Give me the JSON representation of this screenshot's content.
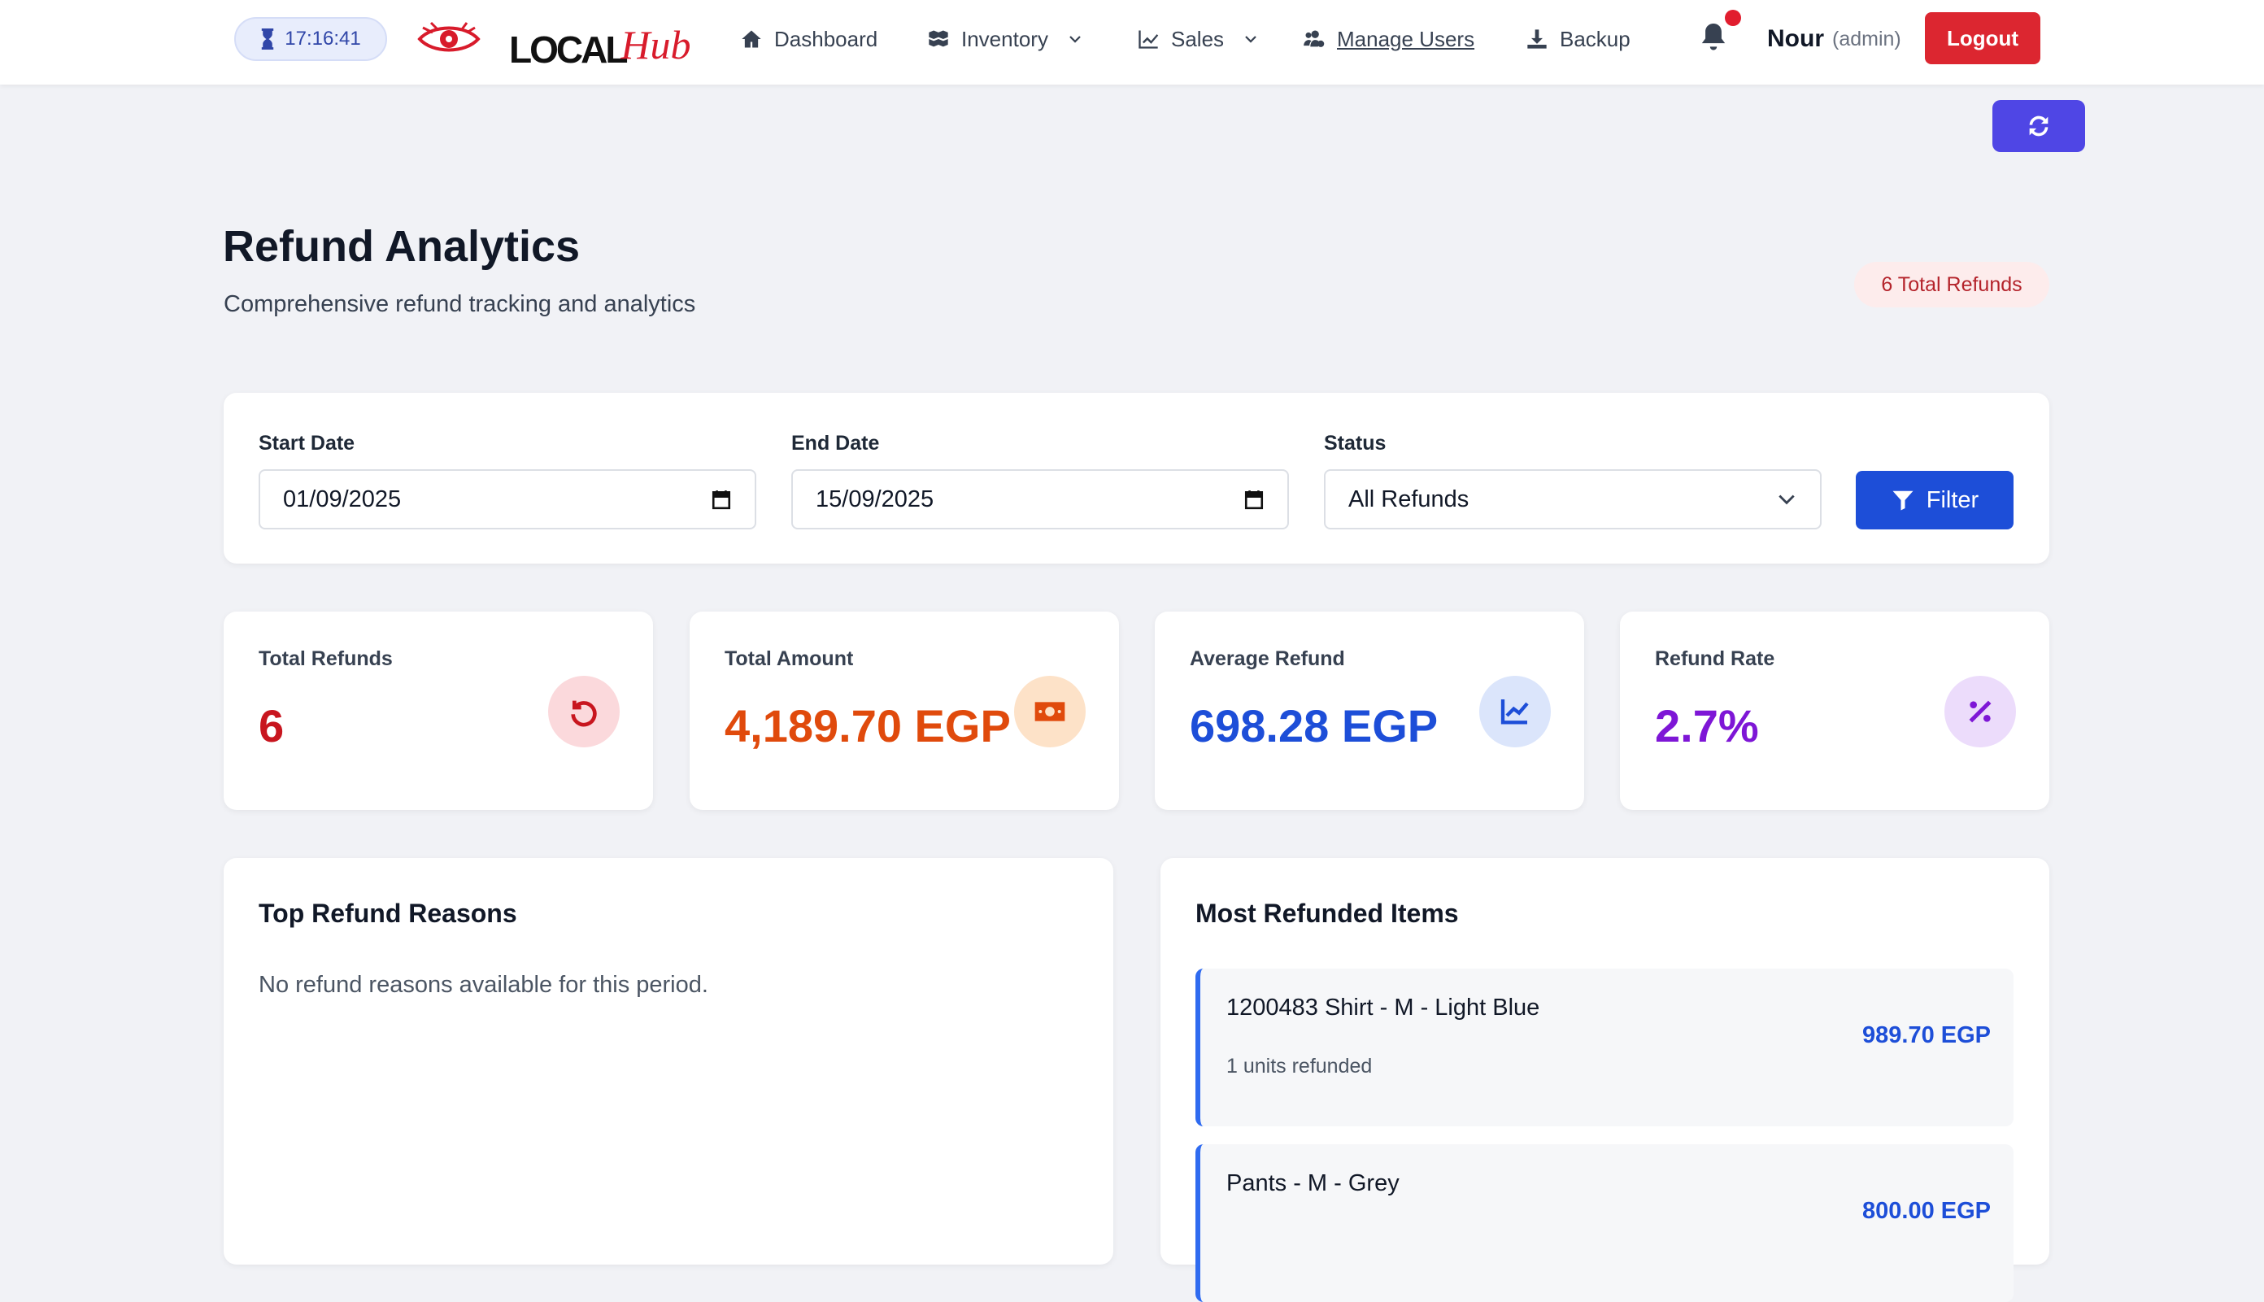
{
  "navbar": {
    "clock": "17:16:41",
    "logo_text_a": "LOCAL",
    "logo_text_b": "Hub",
    "items": [
      {
        "label": "Dashboard"
      },
      {
        "label": "Inventory"
      },
      {
        "label": "Sales"
      },
      {
        "label": "Manage Users"
      },
      {
        "label": "Backup"
      }
    ],
    "user_name": "Nour",
    "user_role": "(admin)",
    "logout_label": "Logout"
  },
  "header": {
    "title": "Refund Analytics",
    "subtitle": "Comprehensive refund tracking and analytics",
    "badge": "6 Total Refunds"
  },
  "filters": {
    "start_label": "Start Date",
    "start_value": "01/09/2025",
    "end_label": "End Date",
    "end_value": "15/09/2025",
    "status_label": "Status",
    "status_value": "All Refunds",
    "filter_label": "Filter"
  },
  "stats": [
    {
      "label": "Total Refunds",
      "value": "6",
      "color": "#c8161f",
      "icon_bg": "#fbd9dc",
      "icon": "undo-icon"
    },
    {
      "label": "Total Amount",
      "value": "4,189.70 EGP",
      "color": "#e04a0c",
      "icon_bg": "#fde2c8",
      "icon": "money-bill-icon"
    },
    {
      "label": "Average Refund",
      "value": "698.28 EGP",
      "color": "#1d4ed8",
      "icon_bg": "#dbe5fb",
      "icon": "chart-line-icon"
    },
    {
      "label": "Refund Rate",
      "value": "2.7%",
      "color": "#7e16d6",
      "icon_bg": "#ecdcfb",
      "icon": "percent-icon"
    }
  ],
  "reasons": {
    "title": "Top Refund Reasons",
    "empty": "No refund reasons available for this period."
  },
  "items": {
    "title": "Most Refunded Items",
    "list": [
      {
        "name": "1200483 Shirt - M - Light Blue",
        "sub": "1 units refunded",
        "amount": "989.70 EGP"
      },
      {
        "name": "Pants - M - Grey",
        "sub": "",
        "amount": "800.00 EGP"
      }
    ]
  }
}
